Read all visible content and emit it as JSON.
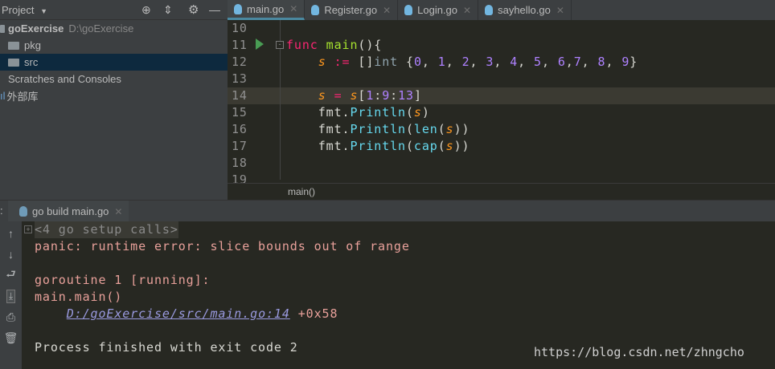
{
  "project": {
    "title": "Project",
    "items": [
      {
        "label": "goExercise",
        "path": "D:\\goExercise"
      },
      {
        "label": "pkg"
      },
      {
        "label": "src"
      },
      {
        "label": "Scratches and Consoles"
      },
      {
        "label": "外部库"
      }
    ]
  },
  "tabs": [
    {
      "label": "main.go",
      "active": true
    },
    {
      "label": "Register.go"
    },
    {
      "label": "Login.go"
    },
    {
      "label": "sayhello.go"
    }
  ],
  "colors": {
    "keyword": "#f92672",
    "func": "#a6e22e",
    "var": "#fd971f",
    "num": "#ae81ff",
    "call": "#66d9ef",
    "type": "#90a4ae",
    "text": "#d8d8d2"
  },
  "editor": {
    "lines": [
      {
        "n": "10",
        "tokens": []
      },
      {
        "n": "11",
        "tokens": [
          [
            "keyword",
            "func"
          ],
          [
            "text",
            " "
          ],
          [
            "func",
            "main"
          ],
          [
            "text",
            "(){"
          ]
        ]
      },
      {
        "n": "12",
        "tokens": [
          [
            "text",
            "    "
          ],
          [
            "var",
            "s"
          ],
          [
            "text",
            " "
          ],
          [
            "keyword",
            ":="
          ],
          [
            "text",
            " []"
          ],
          [
            "type",
            "int"
          ],
          [
            "text",
            " {"
          ],
          [
            "num",
            "0"
          ],
          [
            "text",
            ", "
          ],
          [
            "num",
            "1"
          ],
          [
            "text",
            ", "
          ],
          [
            "num",
            "2"
          ],
          [
            "text",
            ", "
          ],
          [
            "num",
            "3"
          ],
          [
            "text",
            ", "
          ],
          [
            "num",
            "4"
          ],
          [
            "text",
            ", "
          ],
          [
            "num",
            "5"
          ],
          [
            "text",
            ", "
          ],
          [
            "num",
            "6"
          ],
          [
            "text",
            ","
          ],
          [
            "num",
            "7"
          ],
          [
            "text",
            ", "
          ],
          [
            "num",
            "8"
          ],
          [
            "text",
            ", "
          ],
          [
            "num",
            "9"
          ],
          [
            "text",
            "}"
          ]
        ]
      },
      {
        "n": "13",
        "tokens": []
      },
      {
        "n": "14",
        "current": true,
        "tokens": [
          [
            "text",
            "    "
          ],
          [
            "var",
            "s"
          ],
          [
            "text",
            " "
          ],
          [
            "keyword",
            "="
          ],
          [
            "text",
            " "
          ],
          [
            "var",
            "s"
          ],
          [
            "text",
            "["
          ],
          [
            "num",
            "1"
          ],
          [
            "text",
            ":"
          ],
          [
            "num",
            "9"
          ],
          [
            "text",
            ":"
          ],
          [
            "num",
            "13"
          ],
          [
            "text",
            "]"
          ]
        ]
      },
      {
        "n": "15",
        "tokens": [
          [
            "text",
            "    fmt."
          ],
          [
            "call",
            "Println"
          ],
          [
            "text",
            "("
          ],
          [
            "var",
            "s"
          ],
          [
            "text",
            ")"
          ]
        ]
      },
      {
        "n": "16",
        "tokens": [
          [
            "text",
            "    fmt."
          ],
          [
            "call",
            "Println"
          ],
          [
            "text",
            "("
          ],
          [
            "call",
            "len"
          ],
          [
            "text",
            "("
          ],
          [
            "var",
            "s"
          ],
          [
            "text",
            "))"
          ]
        ]
      },
      {
        "n": "17",
        "tokens": [
          [
            "text",
            "    fmt."
          ],
          [
            "call",
            "Println"
          ],
          [
            "text",
            "("
          ],
          [
            "call",
            "cap"
          ],
          [
            "text",
            "("
          ],
          [
            "var",
            "s"
          ],
          [
            "text",
            "))"
          ]
        ]
      },
      {
        "n": "18",
        "tokens": []
      },
      {
        "n": "19",
        "tokens": []
      }
    ],
    "breadcrumb": "main()"
  },
  "run": {
    "tab": "go build main.go",
    "output": {
      "setup": "<4 go setup calls>",
      "panic": "panic: runtime error: slice bounds out of range",
      "goroutine": "goroutine 1 [running]:",
      "frame": "main.main()",
      "link": "D:/goExercise/src/main.go:14",
      "offset": " +0x58",
      "exit": "Process finished with exit code 2"
    }
  },
  "watermark": "https://blog.csdn.net/zhngcho"
}
